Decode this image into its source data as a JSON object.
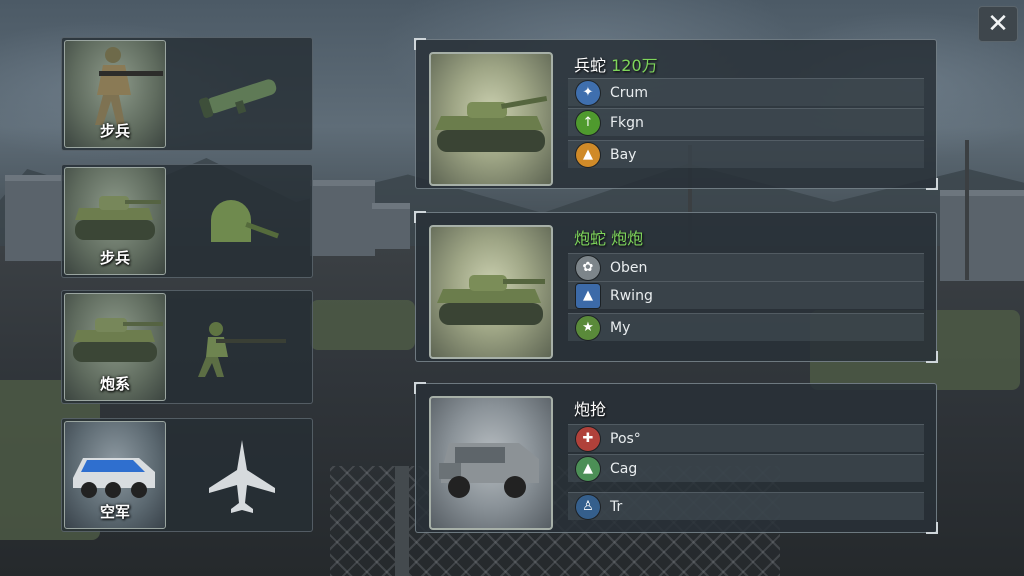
{
  "close": {
    "label": "✕",
    "icon": "close-icon"
  },
  "categories": [
    {
      "label": "步兵",
      "thumb_icon": "infantry-soldier-icon",
      "side_icon": "rocket-launcher-icon"
    },
    {
      "label": "步兵",
      "thumb_icon": "tank-icon",
      "side_icon": "turret-icon"
    },
    {
      "label": "炮系",
      "thumb_icon": "tank-icon",
      "side_icon": "soldier-aiming-icon"
    },
    {
      "label": "空军",
      "thumb_icon": "armored-car-icon",
      "side_icon": "fighter-jet-icon"
    }
  ],
  "units": [
    {
      "title_prefix": "兵蛇 ",
      "title_value": "120万",
      "portrait_icon": "heavy-tank-icon",
      "stats": [
        {
          "icon": "wings-emblem-icon",
          "label": "Crum",
          "color": "#3f6fae"
        },
        {
          "icon": "green-badge-icon",
          "label": "Fkgn",
          "color": "#4f9a2e"
        },
        {
          "icon": "helmet-emblem-icon",
          "label": "Bay",
          "color": "#d08a28"
        }
      ]
    },
    {
      "title_prefix": "",
      "title_value": "炮蛇 炮炮",
      "portrait_icon": "medium-tank-icon",
      "stats": [
        {
          "icon": "cog-cluster-icon",
          "label": "Oben",
          "color": "#7d858a"
        },
        {
          "icon": "eagle-emblem-icon",
          "label": "Rwing",
          "color": "#3c6aa8"
        },
        {
          "icon": "star-emblem-icon",
          "label": "My",
          "color": "#5a8a3a"
        }
      ]
    },
    {
      "title_prefix": "炮抢",
      "title_value": "",
      "portrait_icon": "armored-truck-icon",
      "stats": [
        {
          "icon": "red-green-emblem-icon",
          "label": "Pos°",
          "color": "#b0413a"
        },
        {
          "icon": "green-triangle-icon",
          "label": "Cag",
          "color": "#4c8f56"
        },
        {
          "icon": "soldier-silhouette-icon",
          "label": "Tr",
          "color": "#355f8c"
        }
      ]
    }
  ]
}
